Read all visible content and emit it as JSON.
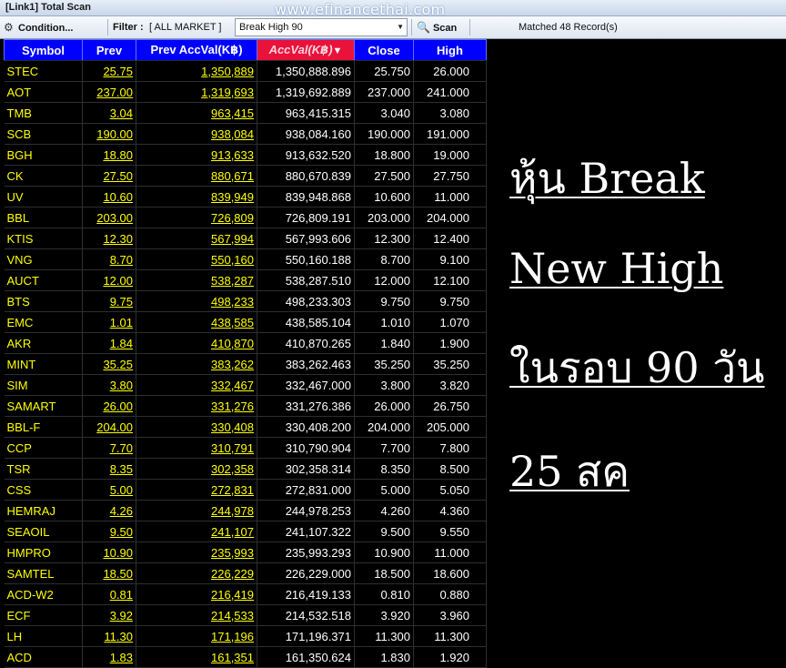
{
  "window": {
    "title": "[Link1] Total Scan"
  },
  "watermark": "www.efinancethai.com",
  "toolbar": {
    "condition_label": "Condition...",
    "filter_label": "Filter :",
    "filter_value": "[ ALL MARKET ]",
    "scan_type": "Break High 90",
    "scan_label": "Scan",
    "matched": "Matched 48 Record(s)"
  },
  "table": {
    "headers": {
      "symbol": "Symbol",
      "prev": "Prev",
      "prev_accval": "Prev AccVal(K฿)",
      "accval": "AccVal(K฿)",
      "sort_arrow": "▼",
      "close": "Close",
      "high": "High"
    },
    "rows": [
      [
        "STEC",
        "25.75",
        "1,350,889",
        "1,350,888.896",
        "25.750",
        "26.000"
      ],
      [
        "AOT",
        "237.00",
        "1,319,693",
        "1,319,692.889",
        "237.000",
        "241.000"
      ],
      [
        "TMB",
        "3.04",
        "963,415",
        "963,415.315",
        "3.040",
        "3.080"
      ],
      [
        "SCB",
        "190.00",
        "938,084",
        "938,084.160",
        "190.000",
        "191.000"
      ],
      [
        "BGH",
        "18.80",
        "913,633",
        "913,632.520",
        "18.800",
        "19.000"
      ],
      [
        "CK",
        "27.50",
        "880,671",
        "880,670.839",
        "27.500",
        "27.750"
      ],
      [
        "UV",
        "10.60",
        "839,949",
        "839,948.868",
        "10.600",
        "11.000"
      ],
      [
        "BBL",
        "203.00",
        "726,809",
        "726,809.191",
        "203.000",
        "204.000"
      ],
      [
        "KTIS",
        "12.30",
        "567,994",
        "567,993.606",
        "12.300",
        "12.400"
      ],
      [
        "VNG",
        "8.70",
        "550,160",
        "550,160.188",
        "8.700",
        "9.100"
      ],
      [
        "AUCT",
        "12.00",
        "538,287",
        "538,287.510",
        "12.000",
        "12.100"
      ],
      [
        "BTS",
        "9.75",
        "498,233",
        "498,233.303",
        "9.750",
        "9.750"
      ],
      [
        "EMC",
        "1.01",
        "438,585",
        "438,585.104",
        "1.010",
        "1.070"
      ],
      [
        "AKR",
        "1.84",
        "410,870",
        "410,870.265",
        "1.840",
        "1.900"
      ],
      [
        "MINT",
        "35.25",
        "383,262",
        "383,262.463",
        "35.250",
        "35.250"
      ],
      [
        "SIM",
        "3.80",
        "332,467",
        "332,467.000",
        "3.800",
        "3.820"
      ],
      [
        "SAMART",
        "26.00",
        "331,276",
        "331,276.386",
        "26.000",
        "26.750"
      ],
      [
        "BBL-F",
        "204.00",
        "330,408",
        "330,408.200",
        "204.000",
        "205.000"
      ],
      [
        "CCP",
        "7.70",
        "310,791",
        "310,790.904",
        "7.700",
        "7.800"
      ],
      [
        "TSR",
        "8.35",
        "302,358",
        "302,358.314",
        "8.350",
        "8.500"
      ],
      [
        "CSS",
        "5.00",
        "272,831",
        "272,831.000",
        "5.000",
        "5.050"
      ],
      [
        "HEMRAJ",
        "4.26",
        "244,978",
        "244,978.253",
        "4.260",
        "4.360"
      ],
      [
        "SEAOIL",
        "9.50",
        "241,107",
        "241,107.322",
        "9.500",
        "9.550"
      ],
      [
        "HMPRO",
        "10.90",
        "235,993",
        "235,993.293",
        "10.900",
        "11.000"
      ],
      [
        "SAMTEL",
        "18.50",
        "226,229",
        "226,229.000",
        "18.500",
        "18.600"
      ],
      [
        "ACD-W2",
        "0.81",
        "216,419",
        "216,419.133",
        "0.810",
        "0.880"
      ],
      [
        "ECF",
        "3.92",
        "214,533",
        "214,532.518",
        "3.920",
        "3.960"
      ],
      [
        "LH",
        "11.30",
        "171,196",
        "171,196.371",
        "11.300",
        "11.300"
      ],
      [
        "ACD",
        "1.83",
        "161,351",
        "161,350.624",
        "1.830",
        "1.920"
      ]
    ]
  },
  "panel": {
    "lines": [
      "หุ้น Break",
      "New High",
      "ในรอบ 90 วัน",
      "25 สค"
    ]
  },
  "colors": {
    "header_bg": "#0000ff",
    "sorted_header_bg": "#e8123a",
    "symbol_text": "#ffff00",
    "value_text": "#ffffff",
    "background": "#000000"
  }
}
